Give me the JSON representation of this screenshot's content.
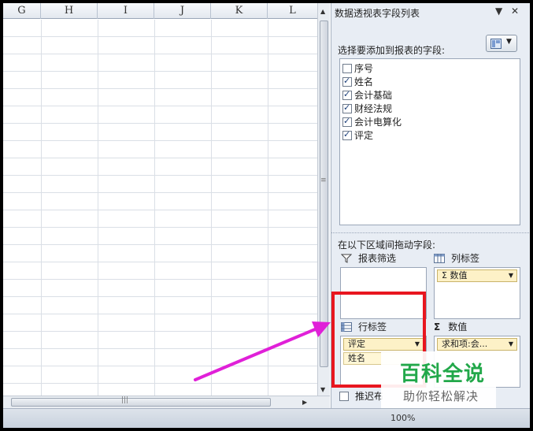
{
  "sheet": {
    "columns": [
      "G",
      "H",
      "I",
      "J",
      "K",
      "L"
    ]
  },
  "panel": {
    "title": "数据透视表字段列表",
    "field_label": "选择要添加到报表的字段:",
    "fields": [
      {
        "label": "序号",
        "checked": false
      },
      {
        "label": "姓名",
        "checked": true
      },
      {
        "label": "会计基础",
        "checked": true
      },
      {
        "label": "财经法规",
        "checked": true
      },
      {
        "label": "会计电算化",
        "checked": true
      },
      {
        "label": "评定",
        "checked": true
      }
    ],
    "area_hint": "在以下区域间拖动字段:",
    "report_filter": "报表筛选",
    "column_labels": "列标签",
    "row_labels": "行标签",
    "values": "数值",
    "column_chip": "Σ 数值",
    "row_chips": [
      "评定",
      "姓名"
    ],
    "value_chip": "求和项:会...",
    "defer_label": "推迟布"
  },
  "status": {
    "zoom": "100%"
  },
  "watermark": {
    "main": "百科全说",
    "sub": "助你轻松解决"
  },
  "colors": {
    "highlight": "#e8161f",
    "arrow": "#e020d8",
    "watermark": "#22a84a"
  }
}
